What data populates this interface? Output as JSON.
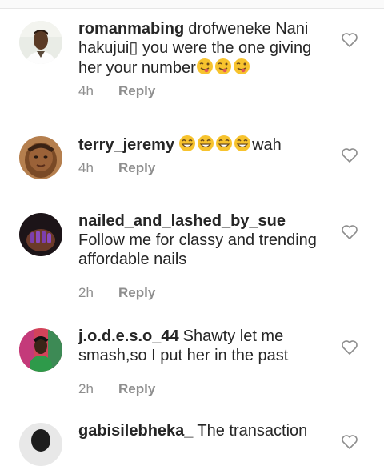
{
  "comments": [
    {
      "username": "romanmabing",
      "text_before": "drofweneke Nani hakujui▯ you were the one giving her your number",
      "emojis": [
        "winking-face-tongue",
        "winking-face-tongue",
        "winking-face-tongue"
      ],
      "text_after": "",
      "time": "4h",
      "reply_label": "Reply"
    },
    {
      "username": "terry_jeremy",
      "text_before": "",
      "emojis": [
        "grinning-face",
        "grinning-face",
        "grinning-face",
        "grinning-face"
      ],
      "text_after": "wah",
      "time": "4h",
      "reply_label": "Reply"
    },
    {
      "username": "nailed_and_lashed_by_sue",
      "text_before": "Follow me for classy and trending affordable nails",
      "emojis": [],
      "text_after": "",
      "time": "2h",
      "reply_label": "Reply"
    },
    {
      "username": "j.o.d.e.s.o_44",
      "text_before": "Shawty let me smash,so I put her in the past",
      "emojis": [],
      "text_after": "",
      "time": "2h",
      "reply_label": "Reply"
    },
    {
      "username": "gabisilebheka_",
      "text_before": "The transaction",
      "emojis": [],
      "text_after": "",
      "time": "",
      "reply_label": ""
    }
  ],
  "colors": {
    "text": "#262626",
    "meta": "#8e8e8e",
    "emoji": "#f7c32e"
  }
}
